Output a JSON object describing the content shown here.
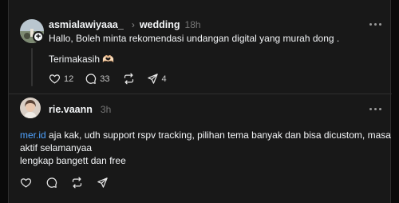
{
  "post": {
    "username": "asmialawiyaaa_",
    "topic": "wedding",
    "time": "18h",
    "line1": "Hallo, Boleh minta rekomendasi undangan digital yang murah dong .",
    "line2": "Terimakasih 🫶🏻",
    "likes": "12",
    "comments": "33",
    "shares": "4"
  },
  "reply": {
    "username": "rie.vaann",
    "time": "3h",
    "mention": "mer.id",
    "line1_rest": " aja kak, udh support rspv tracking, pilihan tema banyak dan bisa dicustom, masa",
    "line2": "aktif selamanyaa",
    "line3": "lengkap bangett dan free"
  },
  "icons": [
    "heart-icon",
    "comment-icon",
    "repost-icon",
    "share-icon",
    "more-icon",
    "plus-icon"
  ],
  "colors": {
    "background": "#181818",
    "page": "#0a0a0a",
    "text": "#f3f5f7",
    "muted": "#777777",
    "link": "#4fa3ff"
  }
}
